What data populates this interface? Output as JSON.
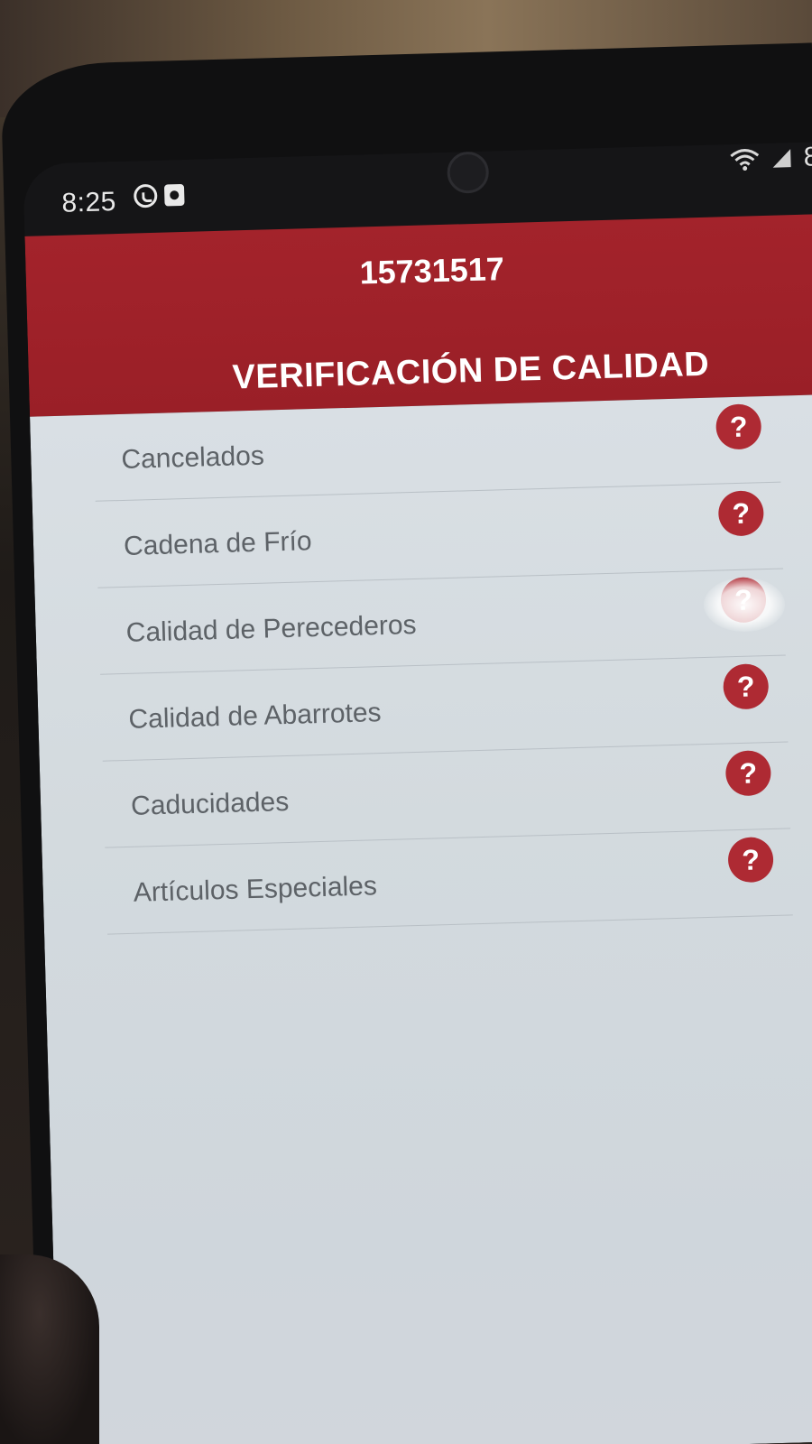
{
  "status_bar": {
    "time": "8:25",
    "battery": "8"
  },
  "header": {
    "store_id": "15731517",
    "title": "VERIFICACIÓN DE CALIDAD"
  },
  "menu": {
    "items": [
      {
        "label": "Cancelados",
        "help": "?"
      },
      {
        "label": "Cadena de Frío",
        "help": "?"
      },
      {
        "label": "Calidad de Perecederos",
        "help": "?"
      },
      {
        "label": "Calidad de Abarrotes",
        "help": "?"
      },
      {
        "label": "Caducidades",
        "help": "?"
      },
      {
        "label": "Artículos Especiales",
        "help": "?"
      }
    ]
  },
  "colors": {
    "brand_red": "#a3232b",
    "help_icon_red": "#ae2a33"
  }
}
